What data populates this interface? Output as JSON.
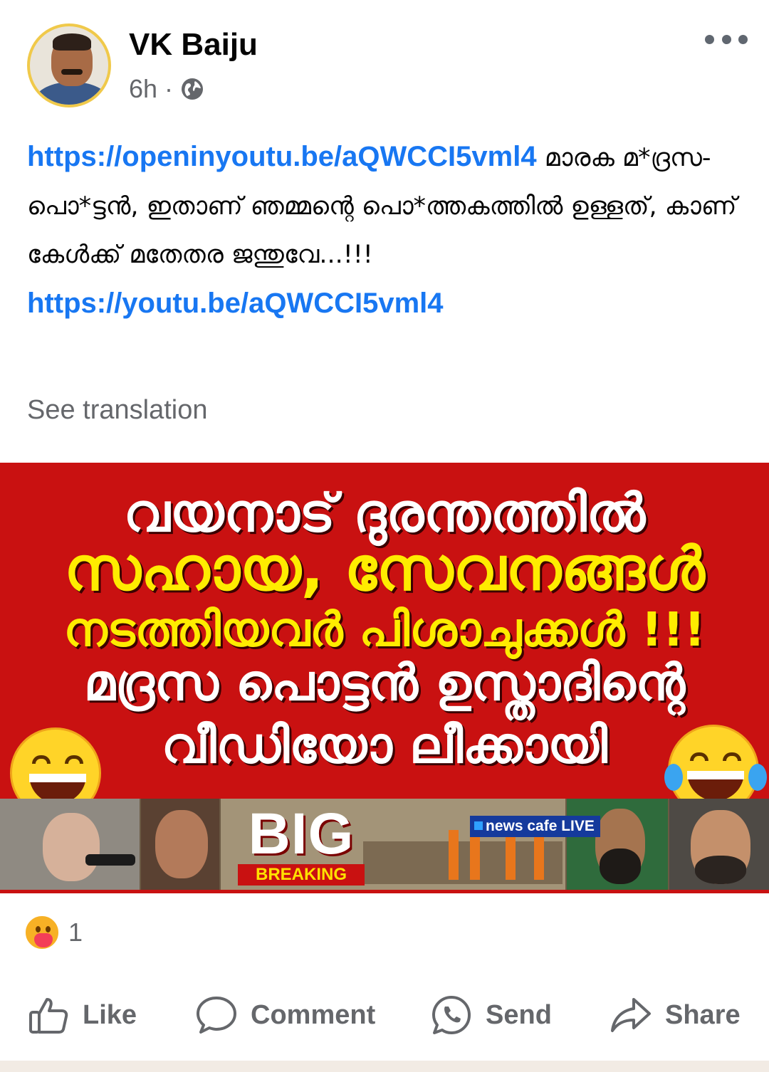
{
  "post": {
    "author": "VK Baiju",
    "time": "6h",
    "separator": "·",
    "privacy_icon": "globe-icon",
    "more_icon": "more-options-icon",
    "link1": "https://openinyoutu.be/aQWCCI5vml4",
    "text_part1": " മാരക മ*ദ്രസ-പൊ*ട്ടൻ, ഇതാണ് ഞമ്മന്റെ പൊ*ത്തകത്തിൽ ഉള്ളത്, കാണ് കേൾക്ക് മതേതര ജന്തുവേ...!!!",
    "link2": "https://youtu.be/aQWCCI5vml4",
    "see_translation": "See translation"
  },
  "image": {
    "line1": "വയനാട് ദുരന്തത്തിൽ",
    "line2": "സഹായ, സേവനങ്ങൾ",
    "line3": "നടത്തിയവർ പിശാചുക്കൾ !!!",
    "line4": "മദ്രസ പൊട്ടൻ ഉസ്താദിന്റെ",
    "line5": "വീഡിയോ ലീക്കായി",
    "big": "BIG",
    "breaking": "BREAKING",
    "live_badge": "news cafe LIVE",
    "colors": {
      "background": "#c91111",
      "highlight": "#ffec00"
    }
  },
  "reactions": {
    "icon": "care-reaction-icon",
    "count": "1"
  },
  "actions": {
    "like": "Like",
    "comment": "Comment",
    "send": "Send",
    "share": "Share"
  }
}
